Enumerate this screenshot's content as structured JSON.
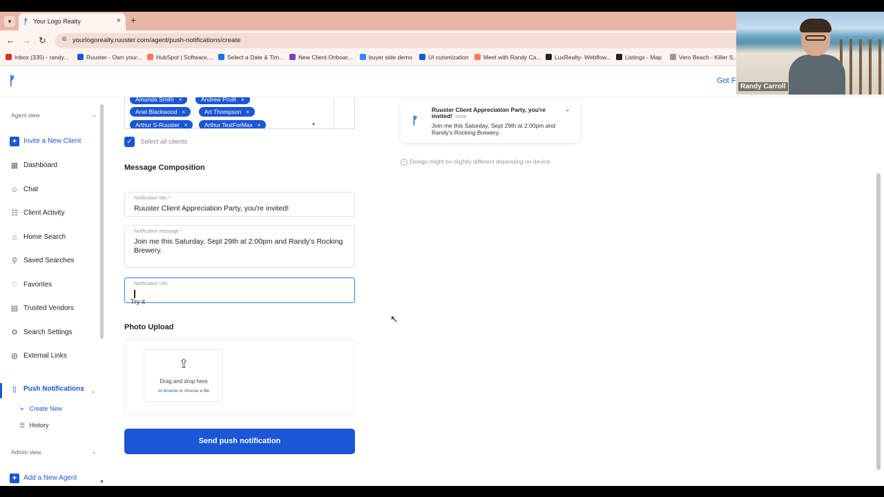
{
  "browser": {
    "tab_title": "Your Logo Realty",
    "tab_close": "×",
    "new_tab": "+",
    "url": "yourlogorealty.ruuster.com/agent/push-notifications/create",
    "bookmarks": [
      {
        "label": "Inbox (335) - randy...",
        "color": "#d93025"
      },
      {
        "label": "Ruuster - Own your...",
        "color": "#1a56d6"
      },
      {
        "label": "HubSpot | Software,...",
        "color": "#ff7a59"
      },
      {
        "label": "Select a Date & Tim...",
        "color": "#1a73e8"
      },
      {
        "label": "New Client Onboar...",
        "color": "#7b3fc4"
      },
      {
        "label": "buyer side demo",
        "color": "#2d8cff"
      },
      {
        "label": "UI cutomization",
        "color": "#1a56d6"
      },
      {
        "label": "Meet with Randy Ca...",
        "color": "#ff7a59"
      },
      {
        "label": "LuxRealty- Webflow...",
        "color": "#222222"
      },
      {
        "label": "Listings - Map",
        "color": "#222222"
      },
      {
        "label": "Vero Beach - Killer S...",
        "color": "#999999"
      }
    ]
  },
  "header": {
    "logo": "ᚠ",
    "right_link": "Got Fe"
  },
  "sidebar": {
    "agent_section": "Agent view",
    "admin_section": "Admin view",
    "items": [
      {
        "label": "Invite a New Client",
        "icon": "+"
      },
      {
        "label": "Dashboard",
        "icon": "▦"
      },
      {
        "label": "Chat",
        "icon": "☺"
      },
      {
        "label": "Client Activity",
        "icon": "☷"
      },
      {
        "label": "Home Search",
        "icon": "⌂"
      },
      {
        "label": "Saved Searches",
        "icon": "⚲"
      },
      {
        "label": "Favorites",
        "icon": "♡"
      },
      {
        "label": "Trusted Vendors",
        "icon": "▤"
      },
      {
        "label": "Search Settings",
        "icon": "⚙"
      },
      {
        "label": "External Links",
        "icon": "◍"
      },
      {
        "label": "Push Notifications",
        "icon": "▯"
      }
    ],
    "sub_items": [
      {
        "label": "Create New",
        "icon": "➢"
      },
      {
        "label": "History",
        "icon": "☰"
      }
    ],
    "admin_items": [
      {
        "label": "Add a New Agent",
        "icon": "+"
      }
    ]
  },
  "recipients": {
    "chips": [
      "Amanda Smith",
      "Andrew Pruitt",
      "Ariel Blackwood",
      "Art Thompson",
      "Arthur S-Ruuster",
      "Arthur TestForMax"
    ],
    "chip_remove": "×",
    "select_all_label": "Select all clients",
    "select_all_checked": true
  },
  "composition": {
    "heading": "Message Composition",
    "title_label": "Notification title *",
    "title_value": "Ruuster Client Appreciation Party, you're invited!",
    "message_label": "Notification message *",
    "message_value": "Join me this Saturday, Sept 29th at 2:00pm and Randy's Rocking Brewery.",
    "url_label": "Notification URL",
    "url_value": "",
    "try_it": "Try it"
  },
  "photo": {
    "heading": "Photo Upload",
    "drag_text": "Drag and drop here",
    "or_text": "or",
    "browse_text": "browse",
    "choose_text": "to choose a file"
  },
  "send_button": "Send push notification",
  "preview": {
    "title": "Ruuster Client Appreciation Party, you're invited!",
    "time": "now",
    "body": "Join me this Saturday, Sept 29th at 2:00pm and Randy's Rocking Brewery.",
    "disclaimer": "Design might be slightly different depending on device"
  },
  "webcam": {
    "name": "Randy Carroll"
  },
  "colors": {
    "brand": "#1a56d6",
    "tabstrip": "#e8b6a4"
  }
}
